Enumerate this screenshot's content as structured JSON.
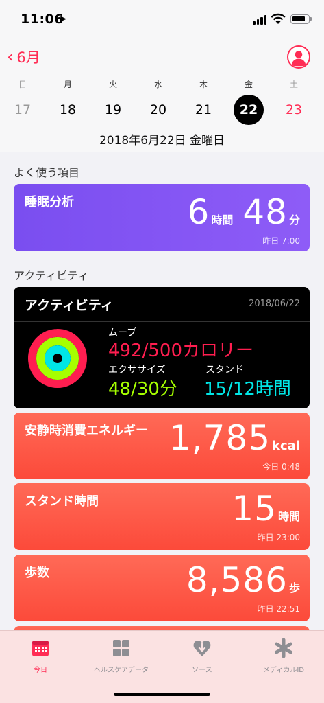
{
  "status_bar": {
    "time": "11:06",
    "location_icon": "location-arrow-icon"
  },
  "header": {
    "back_label": "6月",
    "weekdays": [
      "日",
      "月",
      "火",
      "水",
      "木",
      "金",
      "土"
    ],
    "days": [
      "17",
      "18",
      "19",
      "20",
      "21",
      "22",
      "23"
    ],
    "selected_day": "22",
    "date_line": "2018年6月22日 金曜日"
  },
  "favorites": {
    "section_title": "よく使う項目",
    "sleep": {
      "title": "睡眠分析",
      "hours": "6",
      "hours_unit": "時間",
      "minutes": "48",
      "minutes_unit": "分",
      "timestamp": "昨日 7:00"
    }
  },
  "activity_section": {
    "section_title": "アクティビティ",
    "card": {
      "title": "アクティビティ",
      "date": "2018/06/22",
      "move_label": "ムーブ",
      "move_value": "492/500カロリー",
      "exercise_label": "エクササイズ",
      "exercise_value": "48/30分",
      "stand_label": "スタンド",
      "stand_value": "15/12時間",
      "ring_progress": {
        "move": 0.984,
        "exercise": 1.0,
        "stand": 1.0
      }
    },
    "energy": {
      "title": "安静時消費エネルギー",
      "value": "1,785",
      "unit": "kcal",
      "timestamp": "今日 0:48"
    },
    "stand_time": {
      "title": "スタンド時間",
      "value": "15",
      "unit": "時間",
      "timestamp": "昨日 23:00"
    },
    "steps": {
      "title": "歩数",
      "value": "8,586",
      "unit": "歩",
      "timestamp": "昨日 22:51"
    }
  },
  "tabbar": {
    "tabs": [
      {
        "label": "今日",
        "icon": "calendar-icon"
      },
      {
        "label": "ヘルスケアデータ",
        "icon": "grid-icon"
      },
      {
        "label": "ソース",
        "icon": "heart-download-icon"
      },
      {
        "label": "メディカルID",
        "icon": "asterisk-icon"
      }
    ],
    "active_index": 0
  },
  "colors": {
    "accent": "#ff2d55",
    "sleep_card": "#8457f4",
    "activity_card": "#000000",
    "health_card": "#fc5a46",
    "move": "#ff1e50",
    "exercise": "#a6ff00",
    "stand": "#00e6e6"
  }
}
